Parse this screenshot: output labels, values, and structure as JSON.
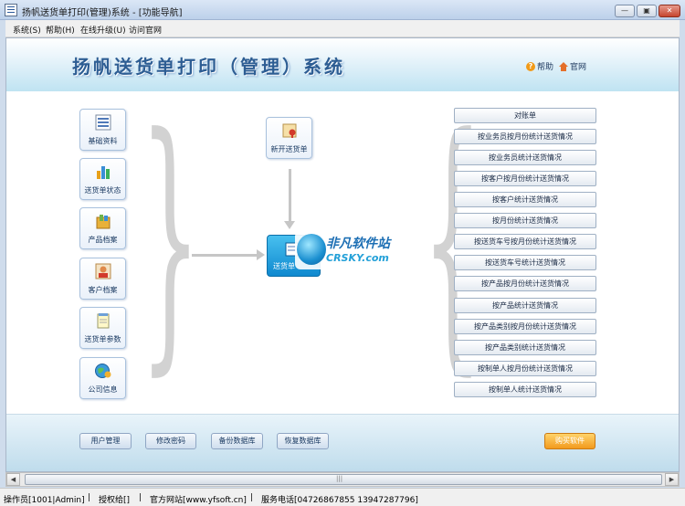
{
  "window": {
    "title": "扬帆送货单打印(管理)系统 - [功能导航]",
    "minimize_glyph": "—",
    "restore_glyph": "▣",
    "close_glyph": "✕"
  },
  "menu": [
    "系统(S)",
    "帮助(H)",
    "在线升级(U)",
    "访问官网"
  ],
  "header": {
    "title": "扬帆送货单打印（管理）系统",
    "help_label": "帮助",
    "site_label": "官网",
    "help_icon": "?"
  },
  "left_tiles": [
    {
      "label": "基础资料",
      "icon": "list-icon"
    },
    {
      "label": "送货单状态",
      "icon": "bar-chart-icon"
    },
    {
      "label": "产品档案",
      "icon": "product-box-icon"
    },
    {
      "label": "客户档案",
      "icon": "customer-icon"
    },
    {
      "label": "送货单参数",
      "icon": "notepad-icon"
    },
    {
      "label": "公司信息",
      "icon": "globe-icon"
    }
  ],
  "new_order": {
    "label": "新开送货单",
    "icon": "certificate-icon"
  },
  "main_tile": {
    "label": "送货单"
  },
  "watermark": {
    "cn": "非凡软件站",
    "en": "CRSKY.com"
  },
  "reports": [
    "对账单",
    "按业务员按月份统计送货情况",
    "按业务员统计送货情况",
    "按客户按月份统计送货情况",
    "按客户统计送货情况",
    "按月份统计送货情况",
    "按送货车号按月份统计送货情况",
    "按送货车号统计送货情况",
    "按产品按月份统计送货情况",
    "按产品统计送货情况",
    "按产品类别按月份统计送货情况",
    "按产品类别统计送货情况",
    "按制单人按月份统计送货情况",
    "按制单人统计送货情况"
  ],
  "footer_buttons": [
    "用户管理",
    "修改密码",
    "备份数据库",
    "恢复数据库"
  ],
  "buy_button": "购买软件",
  "scrollbar": {
    "left_arrow": "◀",
    "right_arrow": "▶",
    "grip": "|||"
  },
  "status": [
    "操作员[1001|Admin]",
    "授权给[]",
    "官方网站[www.yfsoft.cn]",
    "服务电话[04726867855 13947287796]"
  ],
  "colors": {
    "accent": "#1a8fd0",
    "title_blue": "#2d5d93",
    "buy_orange": "#f29a1e"
  }
}
